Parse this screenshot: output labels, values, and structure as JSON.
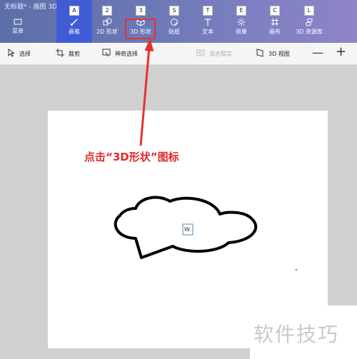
{
  "window": {
    "title": "无标题* - 画图 3D"
  },
  "ribbon": {
    "tabs": [
      {
        "key": "",
        "label": "菜单",
        "icon": "folder-icon"
      },
      {
        "key": "A",
        "label": "画笔",
        "icon": "brush-icon"
      },
      {
        "key": "2",
        "label": "2D 形状",
        "icon": "shapes-2d-icon"
      },
      {
        "key": "3",
        "label": "3D 形状",
        "icon": "cube-icon"
      },
      {
        "key": "S",
        "label": "贴纸",
        "icon": "sticker-icon"
      },
      {
        "key": "T",
        "label": "文本",
        "icon": "text-icon"
      },
      {
        "key": "E",
        "label": "效果",
        "icon": "effects-icon"
      },
      {
        "key": "C",
        "label": "画布",
        "icon": "canvas-icon"
      },
      {
        "key": "L",
        "label": "3D 资源库",
        "icon": "library-icon"
      }
    ]
  },
  "toolbar": {
    "select": "选择",
    "crop": "裁剪",
    "magic_select": "神奇选择",
    "mixed_reality": "混合现实",
    "view_3d": "3D 视图",
    "zoom_out": "—",
    "zoom_in": "+"
  },
  "canvas": {
    "text_box": "W"
  },
  "annotation": {
    "text": "点击“3D形状”图标",
    "color": "#e02a2a"
  },
  "watermark": {
    "text": "软件技巧"
  },
  "colors": {
    "accent": "#3f5cd6",
    "highlight": "#e53232"
  }
}
